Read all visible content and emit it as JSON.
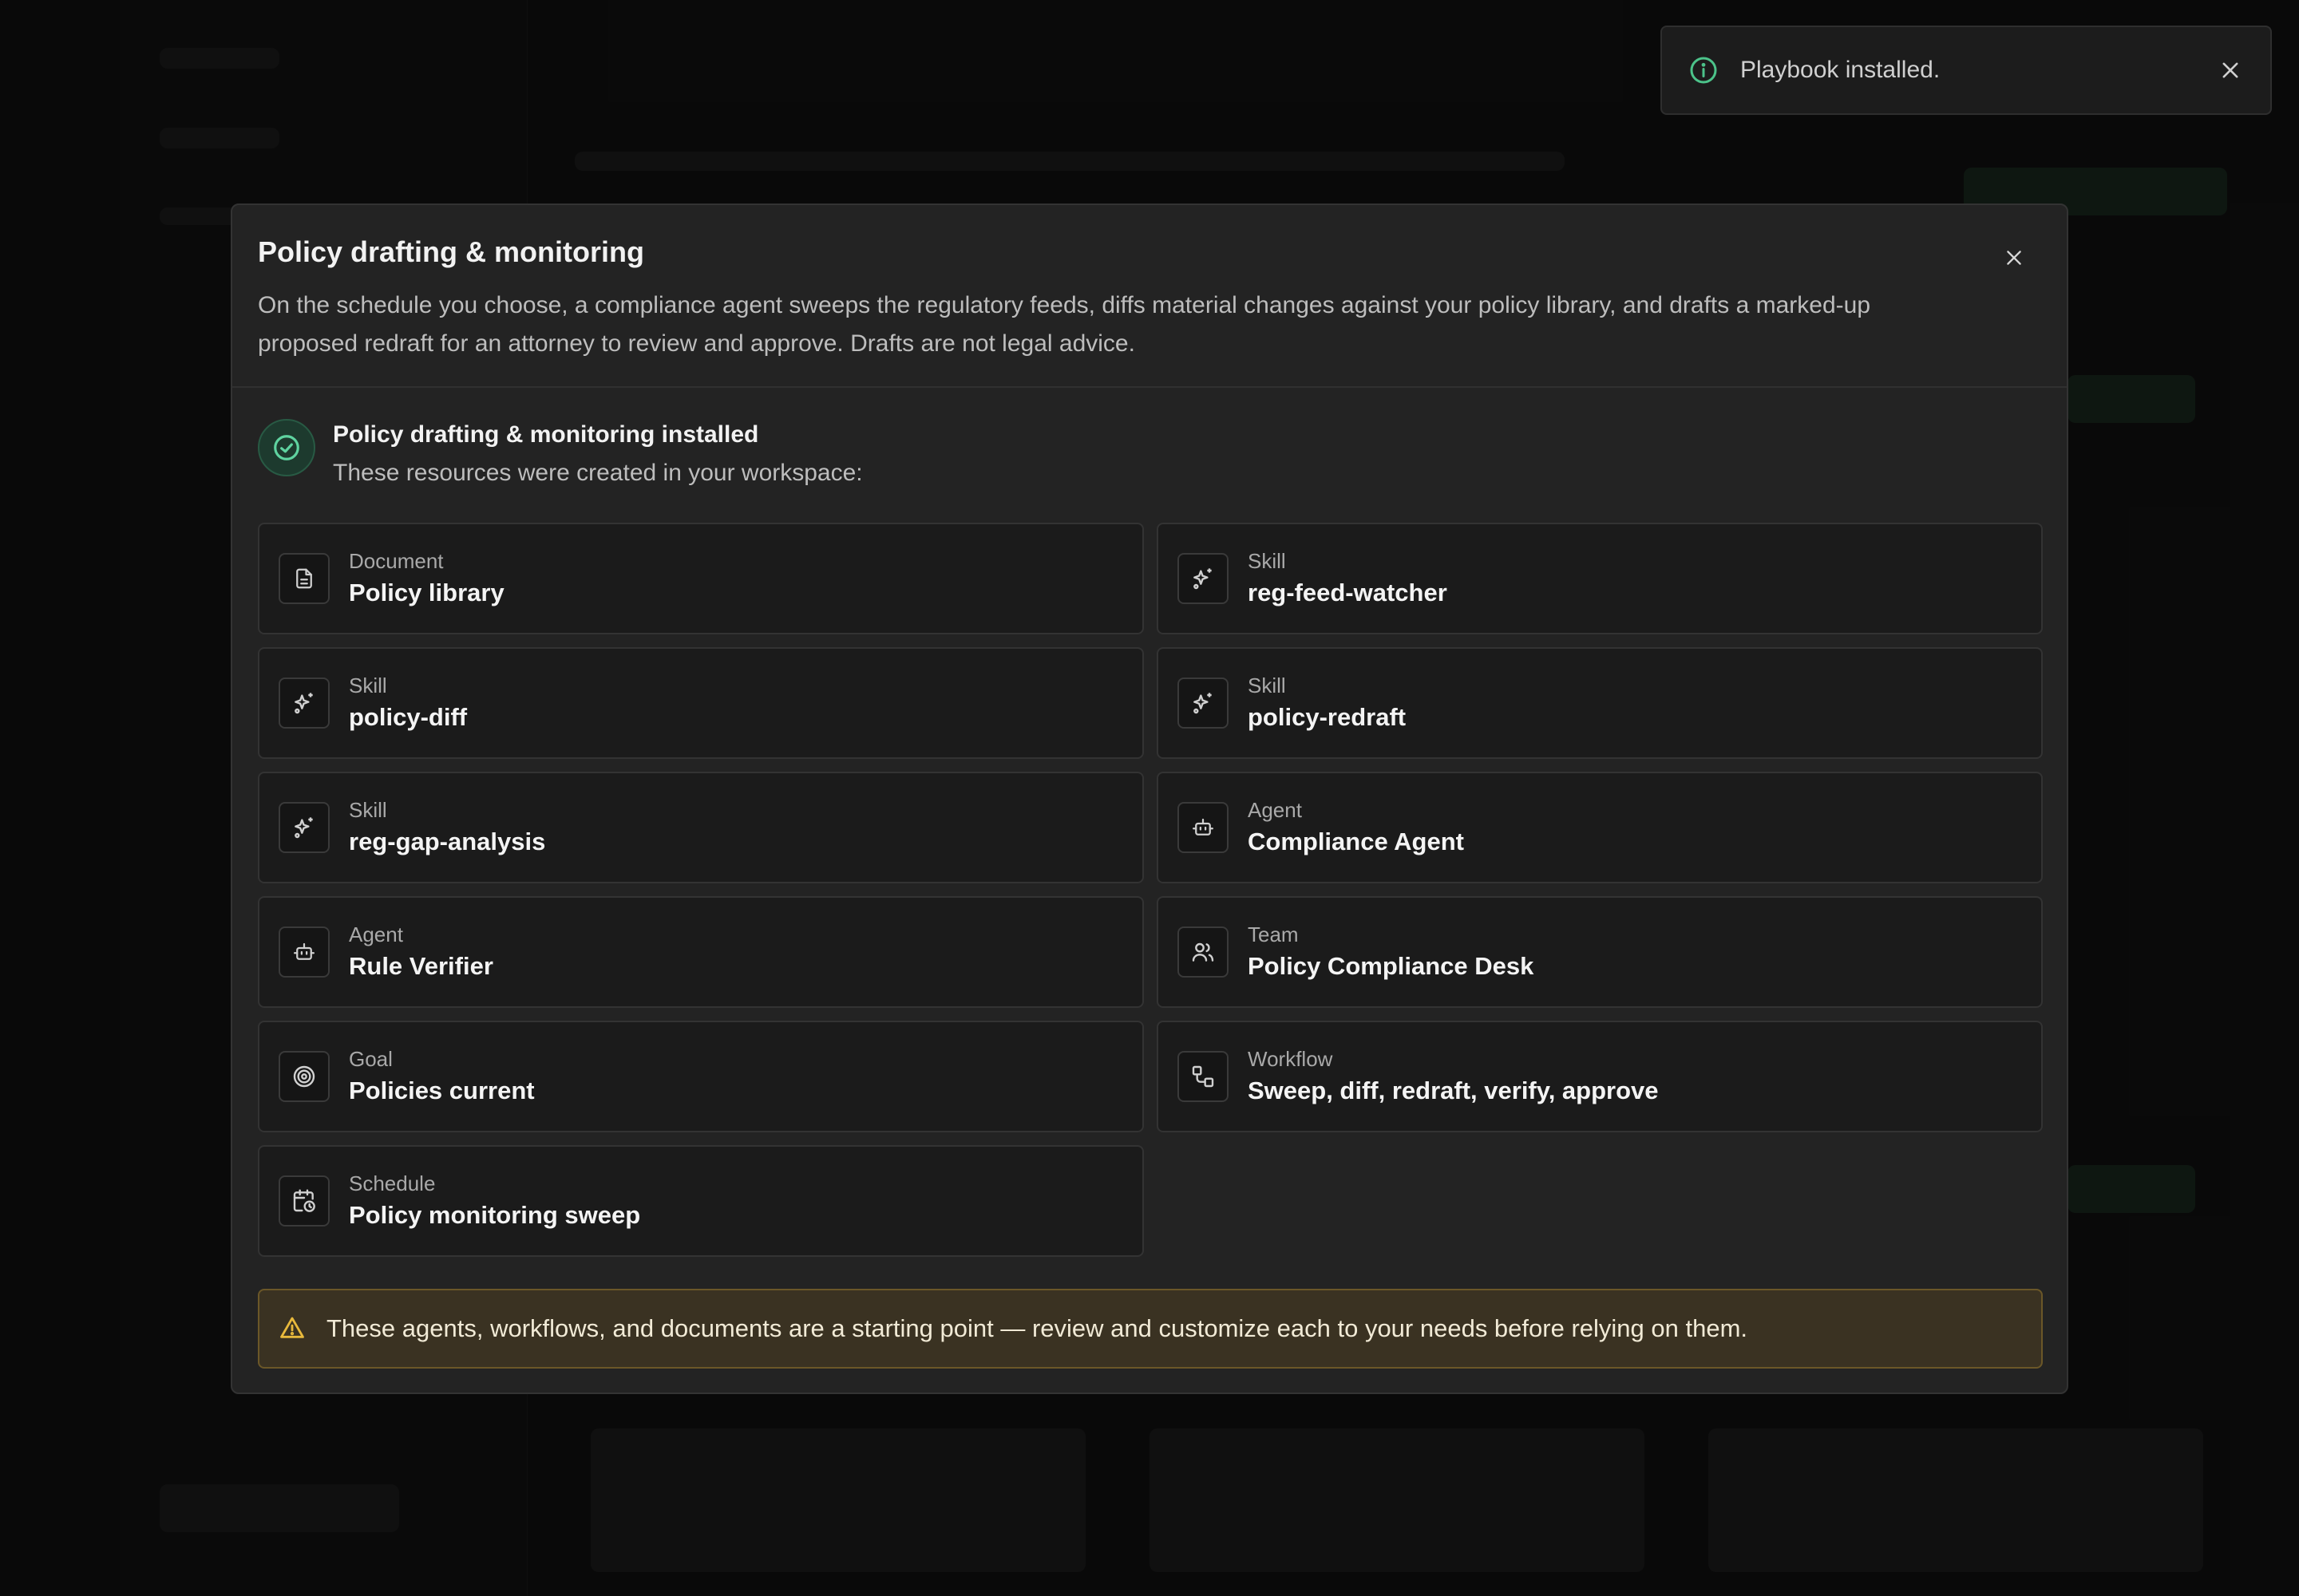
{
  "toast": {
    "message": "Playbook installed."
  },
  "modal": {
    "title": "Policy drafting & monitoring",
    "description": "On the schedule you choose, a compliance agent sweeps the regulatory feeds, diffs material changes against your policy library, and drafts a marked-up proposed redraft for an attorney to review and approve. Drafts are not legal advice.",
    "status": {
      "title": "Policy drafting & monitoring installed",
      "subtitle": "These resources were created in your workspace:"
    },
    "resources": [
      {
        "type": "Document",
        "name": "Policy library",
        "icon": "document-icon"
      },
      {
        "type": "Skill",
        "name": "reg-feed-watcher",
        "icon": "sparkle-icon"
      },
      {
        "type": "Skill",
        "name": "policy-diff",
        "icon": "sparkle-icon"
      },
      {
        "type": "Skill",
        "name": "policy-redraft",
        "icon": "sparkle-icon"
      },
      {
        "type": "Skill",
        "name": "reg-gap-analysis",
        "icon": "sparkle-icon"
      },
      {
        "type": "Agent",
        "name": "Compliance Agent",
        "icon": "bot-icon"
      },
      {
        "type": "Agent",
        "name": "Rule Verifier",
        "icon": "bot-icon"
      },
      {
        "type": "Team",
        "name": "Policy Compliance Desk",
        "icon": "users-icon"
      },
      {
        "type": "Goal",
        "name": "Policies current",
        "icon": "target-icon"
      },
      {
        "type": "Workflow",
        "name": "Sweep, diff, redraft, verify, approve",
        "icon": "workflow-icon"
      },
      {
        "type": "Schedule",
        "name": "Policy monitoring sweep",
        "icon": "calendar-clock-icon"
      }
    ],
    "warning": "These agents, workflows, and documents are a starting point — review and customize each to your needs before relying on them."
  },
  "colors": {
    "accent_green": "#3fae7e",
    "warning_yellow": "#e8b93c",
    "info_green": "#4cc38a"
  }
}
